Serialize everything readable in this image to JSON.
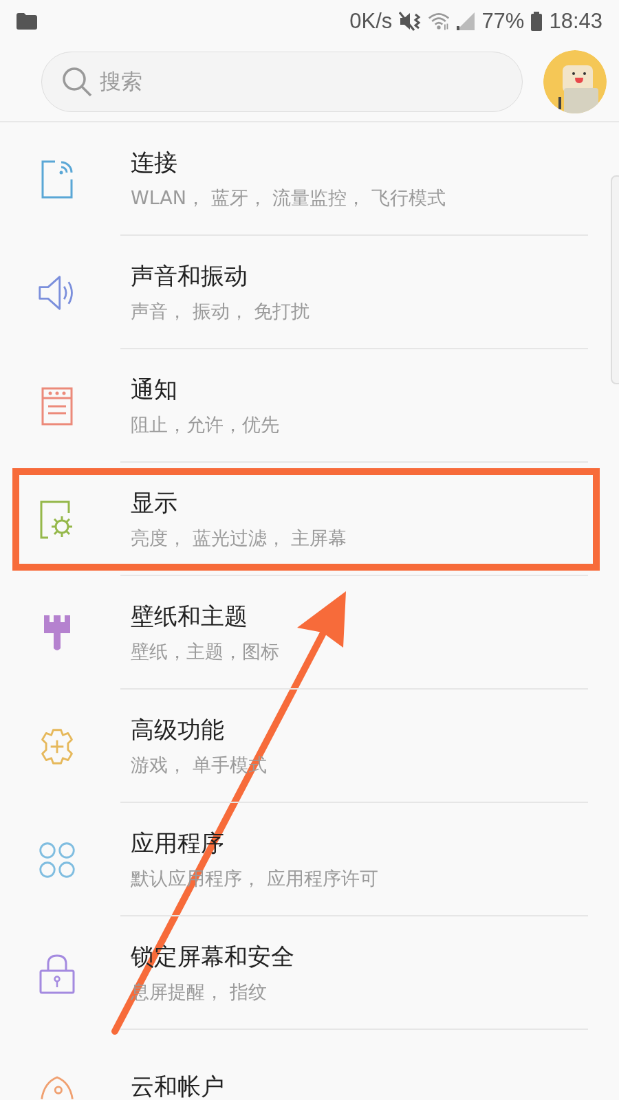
{
  "status_bar": {
    "speed": "0K/s",
    "battery": "77%",
    "time": "18:43"
  },
  "search": {
    "placeholder": "搜索"
  },
  "items": [
    {
      "title": "连接",
      "subtitle": "WLAN， 蓝牙， 流量监控， 飞行模式",
      "highlighted": false
    },
    {
      "title": "声音和振动",
      "subtitle": "声音， 振动， 免打扰",
      "highlighted": false
    },
    {
      "title": "通知",
      "subtitle": "阻止，允许，优先",
      "highlighted": false
    },
    {
      "title": "显示",
      "subtitle": "亮度， 蓝光过滤， 主屏幕",
      "highlighted": true
    },
    {
      "title": "壁纸和主题",
      "subtitle": "壁纸，主题，图标",
      "highlighted": false
    },
    {
      "title": "高级功能",
      "subtitle": "游戏， 单手模式",
      "highlighted": false
    },
    {
      "title": "应用程序",
      "subtitle": "默认应用程序， 应用程序许可",
      "highlighted": false
    },
    {
      "title": "锁定屏幕和安全",
      "subtitle": "息屏提醒， 指纹",
      "highlighted": false
    },
    {
      "title": "云和帐户"
    }
  ]
}
